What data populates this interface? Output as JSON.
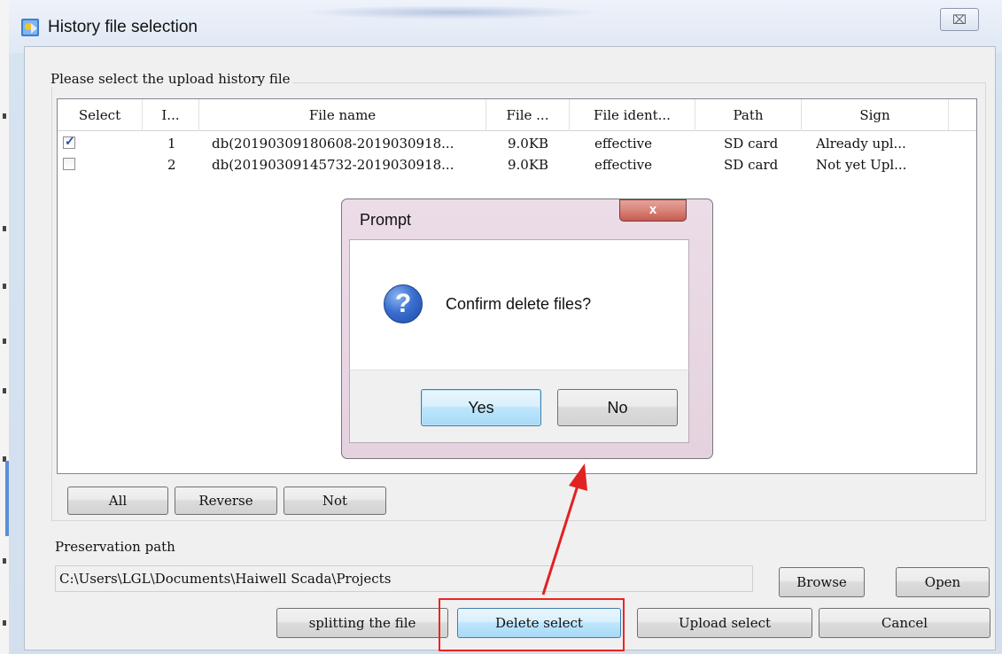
{
  "window": {
    "title": "History file selection",
    "close_glyph": "⌧",
    "app_icon": "app-icon"
  },
  "group": {
    "label": "Please select the upload history file"
  },
  "table": {
    "columns": [
      "Select",
      "I...",
      "File name",
      "File ...",
      "File ident...",
      "Path",
      "Sign"
    ],
    "rows": [
      {
        "checked": true,
        "index": "1",
        "file_name": "db(20190309180608-2019030918...",
        "file_size": "9.0KB",
        "identity": "effective",
        "path": "SD card",
        "sign": "Already upl..."
      },
      {
        "checked": false,
        "index": "2",
        "file_name": "db(20190309145732-2019030918...",
        "file_size": "9.0KB",
        "identity": "effective",
        "path": "SD card",
        "sign": "Not yet Upl..."
      }
    ]
  },
  "selection_buttons": {
    "all": "All",
    "reverse": "Reverse",
    "not": "Not"
  },
  "preservation": {
    "label": "Preservation path",
    "value": "C:\\Users\\LGL\\Documents\\Haiwell Scada\\Projects",
    "browse": "Browse",
    "open": "Open"
  },
  "actions": {
    "split": "splitting the file",
    "delete": "Delete select",
    "upload": "Upload select",
    "cancel": "Cancel"
  },
  "prompt": {
    "title": "Prompt",
    "close_glyph": "x",
    "message": "Confirm delete files?",
    "icon_glyph": "?",
    "yes": "Yes",
    "no": "No"
  },
  "colors": {
    "annotation_red": "#e22222"
  }
}
